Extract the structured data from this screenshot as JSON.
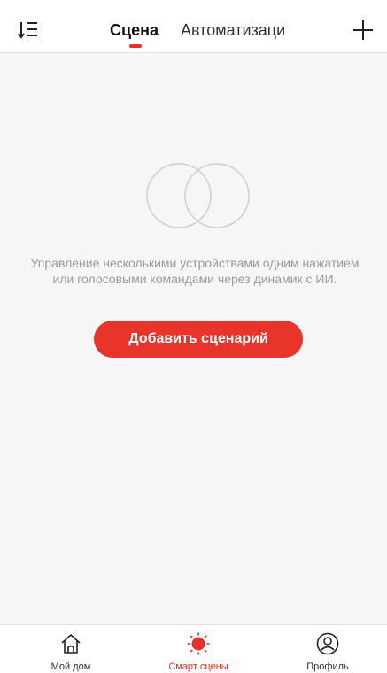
{
  "header": {
    "sort_icon": "sort-list-icon",
    "tabs": [
      {
        "label": "Сцена",
        "active": true
      },
      {
        "label": "Автоматизаци",
        "active": false
      }
    ],
    "add_icon": "plus-icon"
  },
  "empty_state": {
    "icon": "overlapping-circles-icon",
    "description": "Управление несколькими устройствами одним нажатием или голосовыми командами через динамик с ИИ.",
    "button_label": "Добавить сценарий"
  },
  "bottom_nav": {
    "items": [
      {
        "label": "Мой дом",
        "icon": "home-icon",
        "active": false
      },
      {
        "label": "Смарт сцены",
        "icon": "sun-icon",
        "active": true
      },
      {
        "label": "Профиль",
        "icon": "profile-icon",
        "active": false
      }
    ]
  },
  "colors": {
    "accent": "#e8302a",
    "background": "#f6f6f6",
    "muted_text": "#9a9a9a"
  }
}
